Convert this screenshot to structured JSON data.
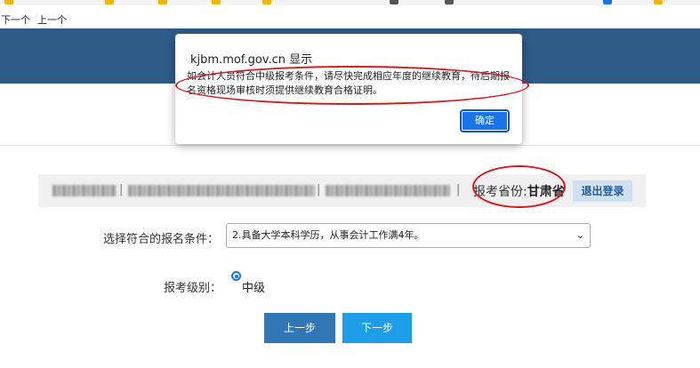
{
  "browser": {
    "find_next": "下一个",
    "find_prev": "上一个",
    "bookmark_colors": [
      "#f2b500",
      "#f2b500",
      "#f2b500",
      "#f2b500",
      "#f2b500",
      "#555555",
      "#555555",
      "#1a73e8",
      "#f2b500"
    ]
  },
  "dialog": {
    "origin": "kjbm.mof.gov.cn 显示",
    "message": "如会计人员符合中级报考条件，请尽快完成相应年度的继续教育，待后期报名资格现场审核时须提供继续教育合格证明。",
    "ok_label": "确定"
  },
  "info_bar": {
    "separator": "|",
    "province_label": "报考省份:",
    "province_value": "甘肃省",
    "logout_label": "退出登录"
  },
  "form": {
    "condition_label": "选择符合的报名条件：",
    "condition_selected": "2.具备大学本科学历，从事会计工作满4年。",
    "level_label": "报考级别：",
    "level_value": "中级",
    "prev_label": "上一步",
    "next_label": "下一步"
  },
  "colors": {
    "header": "#2e5b88",
    "annotation": "#d71920",
    "primary_button": "#2f78b5",
    "secondary_button": "#1e9de8"
  }
}
